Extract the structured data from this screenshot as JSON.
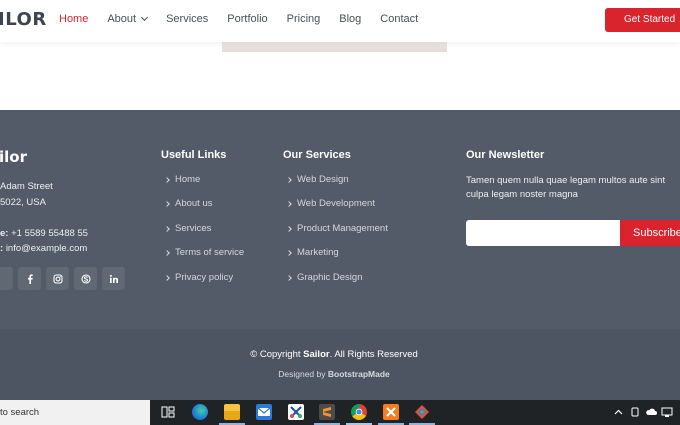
{
  "header": {
    "logo": "ILOR",
    "nav": [
      {
        "label": "Home",
        "active": true
      },
      {
        "label": "About",
        "dropdown": true
      },
      {
        "label": "Services"
      },
      {
        "label": "Portfolio"
      },
      {
        "label": "Pricing"
      },
      {
        "label": "Blog"
      },
      {
        "label": "Contact"
      }
    ],
    "cta": "Get Started"
  },
  "footer": {
    "brand": "ilor",
    "address_line1": "Adam Street",
    "address_line2": "5022, USA",
    "phone_label": "e:",
    "phone_value": "+1 5589 55488 55",
    "email_label": ":",
    "email_value": "info@example.com",
    "socials": [
      "facebook-icon",
      "instagram-icon",
      "skype-icon",
      "linkedin-icon"
    ],
    "useful_links": {
      "title": "Useful Links",
      "items": [
        "Home",
        "About us",
        "Services",
        "Terms of service",
        "Privacy policy"
      ]
    },
    "services": {
      "title": "Our Services",
      "items": [
        "Web Design",
        "Web Development",
        "Product Management",
        "Marketing",
        "Graphic Design"
      ]
    },
    "newsletter": {
      "title": "Our Newsletter",
      "text": "Tamen quem nulla quae legam multos aute sint culpa legam noster magna",
      "input_value": "",
      "button": "Subscribe"
    },
    "copyright_prefix": "© Copyright",
    "copyright_brand": "Sailor",
    "copyright_suffix": ". All Rights Reserved",
    "designed_prefix": "Designed by",
    "designed_brand": "BootstrapMade"
  },
  "taskbar": {
    "search": "to search"
  },
  "colors": {
    "accent": "#d9232d",
    "footer_bg": "#525b67",
    "footer_bottom_bg": "#4c5561"
  }
}
